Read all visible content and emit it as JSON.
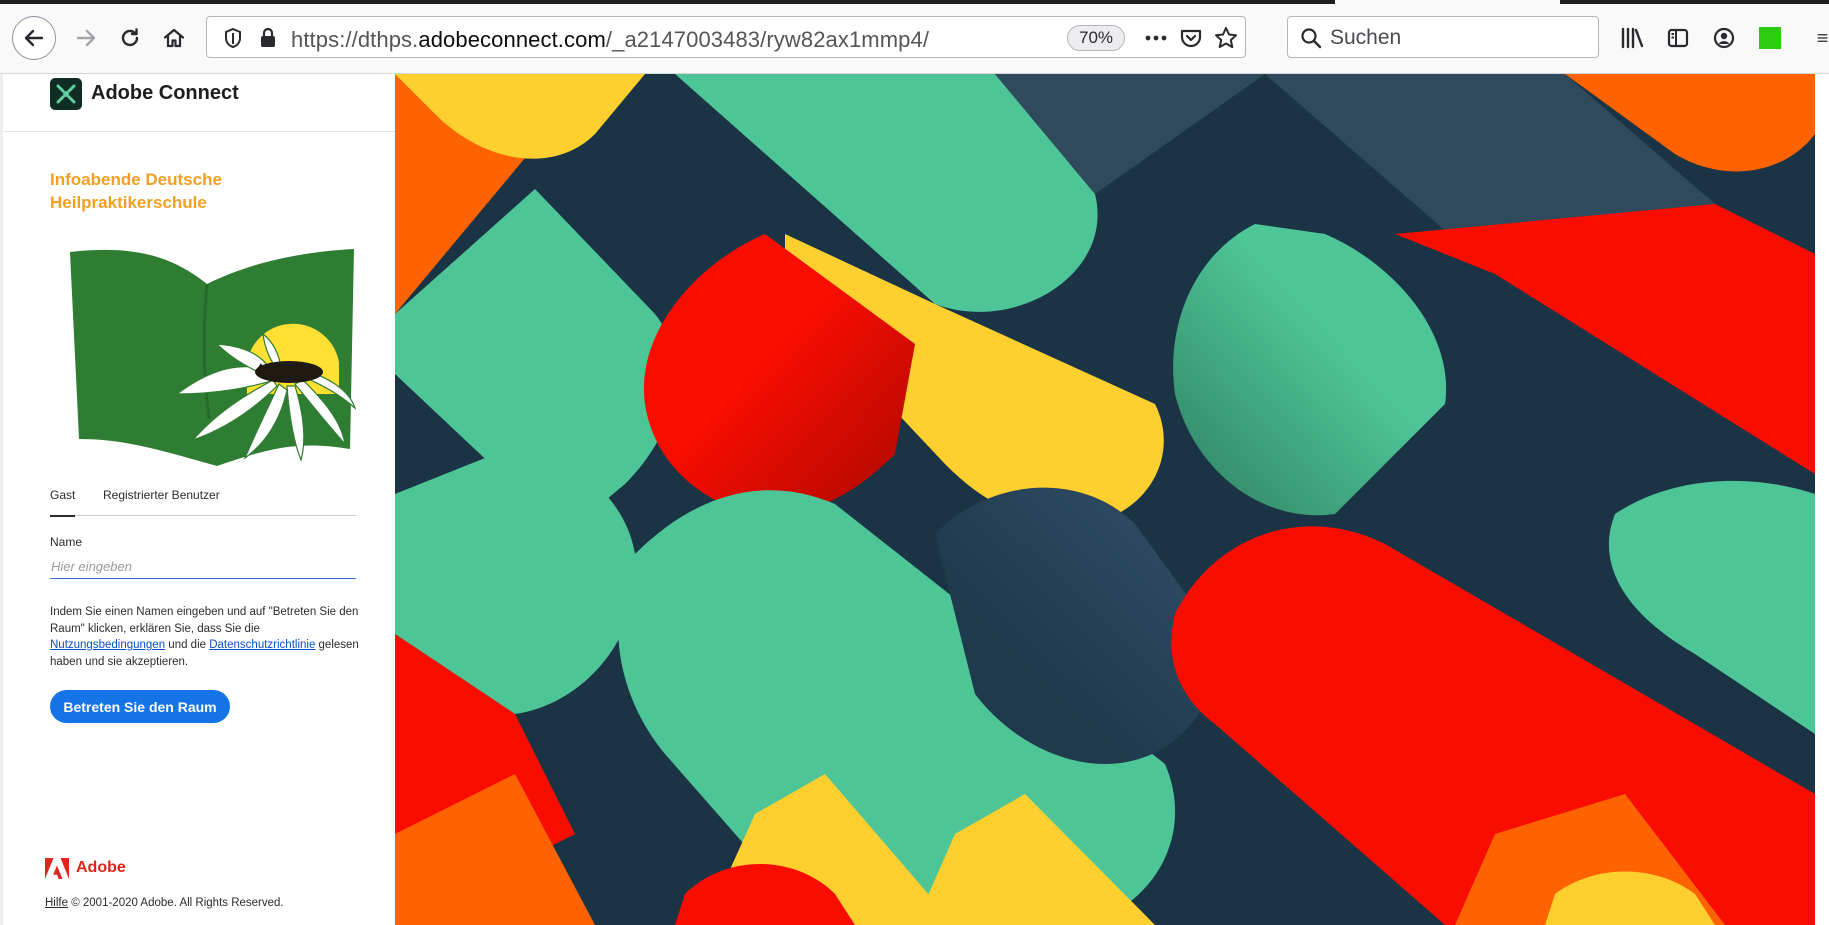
{
  "browser": {
    "url_prefix": "https://dthps.",
    "url_host": "adobeconnect.com",
    "url_path": "/_a2147003483/ryw82ax1mmp4/",
    "zoom": "70%",
    "search_placeholder": "Suchen"
  },
  "header": {
    "brand_name": "Adobe Connect"
  },
  "room": {
    "title": "Infoabende Deutsche Heilpraktikerschule"
  },
  "login": {
    "tabs": [
      "Gast",
      "Registrierter Benutzer"
    ],
    "name_label": "Name",
    "name_value": "",
    "name_placeholder": "Hier eingeben",
    "consent_start": "Indem Sie einen Namen eingeben und auf \"Betreten Sie den Raum\" klicken, erklären Sie, dass Sie die ",
    "terms_link": "Nutzungsbedingungen",
    "consent_middle": " und die ",
    "privacy_link": "Datenschutzrichtlinie",
    "consent_end": " gelesen haben und sie akzeptieren.",
    "enter_button": "Betreten Sie den Raum"
  },
  "footer": {
    "adobe_word": "Adobe",
    "help_link": "Hilfe",
    "copyright": " © 2001-2020 Adobe. All Rights Reserved."
  },
  "colors": {
    "accent_blue": "#1473e6",
    "org_orange": "#f2a023",
    "adobe_red": "#e1251b",
    "art_navy": "#1b3445",
    "art_slate": "#2f4a5d",
    "art_green": "#4ec596",
    "art_yellow": "#fdd02f",
    "art_red": "#f80d00",
    "art_orange": "#ff6300"
  },
  "icons": [
    "back-arrow-icon",
    "forward-arrow-icon",
    "reload-icon",
    "home-icon",
    "shield-icon",
    "lock-icon",
    "more-icon",
    "pocket-icon",
    "star-icon",
    "search-icon",
    "library-icon",
    "sidebar-icon",
    "account-icon",
    "extension-icon",
    "menu-icon"
  ]
}
